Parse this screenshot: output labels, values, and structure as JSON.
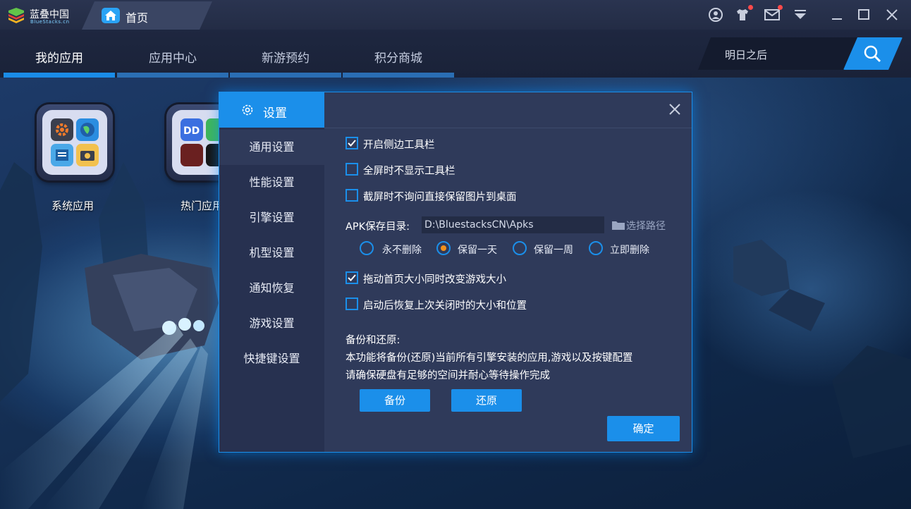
{
  "titlebar": {
    "logo_name": "蓝叠中国",
    "logo_sub": "BlueStacks.cn",
    "home_tab": "首页",
    "icons": [
      "user-icon",
      "shirt-icon",
      "mail-icon",
      "dropdown-menu-icon",
      "minimize-icon",
      "maximize-icon",
      "close-icon"
    ]
  },
  "nav": {
    "tabs": [
      "我的应用",
      "应用中心",
      "新游预约",
      "积分商城"
    ],
    "active": 0
  },
  "search": {
    "text": "明日之后"
  },
  "desktop": {
    "apps": [
      {
        "label": "系统应用"
      },
      {
        "label": "热门应用"
      }
    ]
  },
  "dialog": {
    "title": "设置",
    "sidebar": [
      "通用设置",
      "性能设置",
      "引擎设置",
      "机型设置",
      "通知恢复",
      "游戏设置",
      "快捷键设置"
    ],
    "active_item": 0,
    "options": [
      {
        "label": "开启侧边工具栏",
        "checked": true
      },
      {
        "label": "全屏时不显示工具栏",
        "checked": false
      },
      {
        "label": "截屏时不询问直接保留图片到桌面",
        "checked": false
      },
      {
        "label": "拖动首页大小同时改变游戏大小",
        "checked": true
      },
      {
        "label": "启动后恢复上次关闭时的大小和位置",
        "checked": false
      }
    ],
    "apk_label": "APK保存目录:",
    "apk_path": "D:\\BluestacksCN\\Apks",
    "browse_label": "选择路径",
    "radios": [
      {
        "label": "永不删除",
        "selected": false
      },
      {
        "label": "保留一天",
        "selected": true
      },
      {
        "label": "保留一周",
        "selected": false
      },
      {
        "label": "立即删除",
        "selected": false
      }
    ],
    "backup_title": "备份和还原:",
    "backup_line1": "本功能将备份(还原)当前所有引擎安装的应用,游戏以及按键配置",
    "backup_line2": "请确保硬盘有足够的空间并耐心等待操作完成",
    "backup_button": "备份",
    "restore_button": "还原",
    "ok_button": "确定"
  },
  "colors": {
    "accent": "#1b8fea",
    "radio_dot": "#f0911c",
    "dialog_bg": "#2f3a5a"
  }
}
